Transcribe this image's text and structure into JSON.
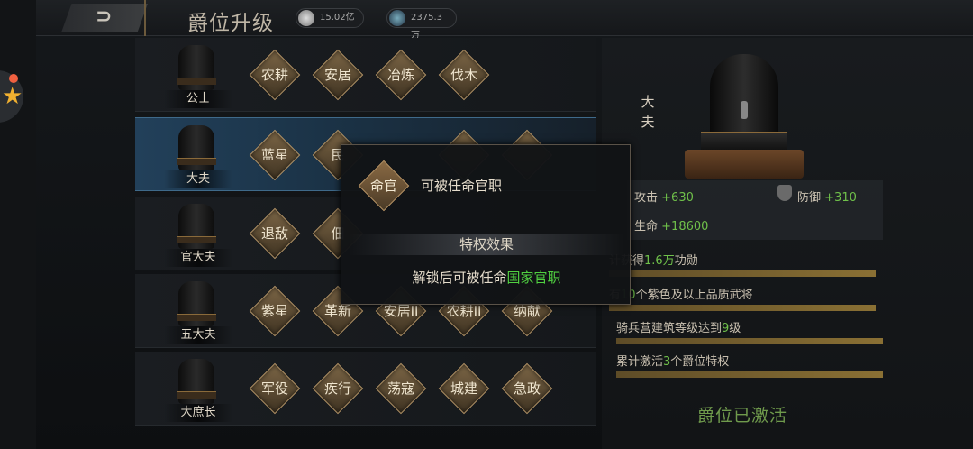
{
  "header": {
    "title": "爵位升级",
    "back_icon": "back-arrow-icon",
    "resources": [
      {
        "name": "silver-coin-icon",
        "value": "15.02亿"
      },
      {
        "name": "merit-gem-icon",
        "value": "2375.3万"
      }
    ]
  },
  "ranks": [
    {
      "name": "公士",
      "privileges": [
        "农耕",
        "安居",
        "冶炼",
        "伐木"
      ],
      "selected": false
    },
    {
      "name": "大夫",
      "privileges": [
        "蓝星",
        "民"
      ],
      "selected": true
    },
    {
      "name": "官大夫",
      "privileges": [
        "退敌",
        "佃"
      ],
      "selected": false
    },
    {
      "name": "五大夫",
      "privileges": [
        "紫星",
        "革新",
        "安居II",
        "农耕II",
        "纳献"
      ],
      "selected": false
    },
    {
      "name": "大庶长",
      "privileges": [
        "军役",
        "疾行",
        "荡寇",
        "城建",
        "急政"
      ],
      "selected": false
    }
  ],
  "detail": {
    "rank_name": "大夫",
    "stats": {
      "attack_label": "攻击",
      "attack_value": "+630",
      "defense_label": "防御",
      "defense_value": "+310",
      "hp_label": "生命",
      "hp_value": "+18600"
    },
    "requirements": [
      {
        "pre": "计获得",
        "value": "1.6万",
        "post": "功勋"
      },
      {
        "pre": "有",
        "value": "10",
        "post": "个紫色及以上品质武将"
      },
      {
        "pre": "骑兵营建筑等级达到",
        "value": "9",
        "post": "级"
      },
      {
        "pre": "累计激活",
        "value": "3",
        "post": "个爵位特权"
      }
    ],
    "status": "爵位已激活"
  },
  "popup": {
    "badge": "命官",
    "headline": "可被任命官职",
    "section_title": "特权效果",
    "desc_pre": "解锁后可被任命",
    "desc_highlight": "国家官职"
  }
}
